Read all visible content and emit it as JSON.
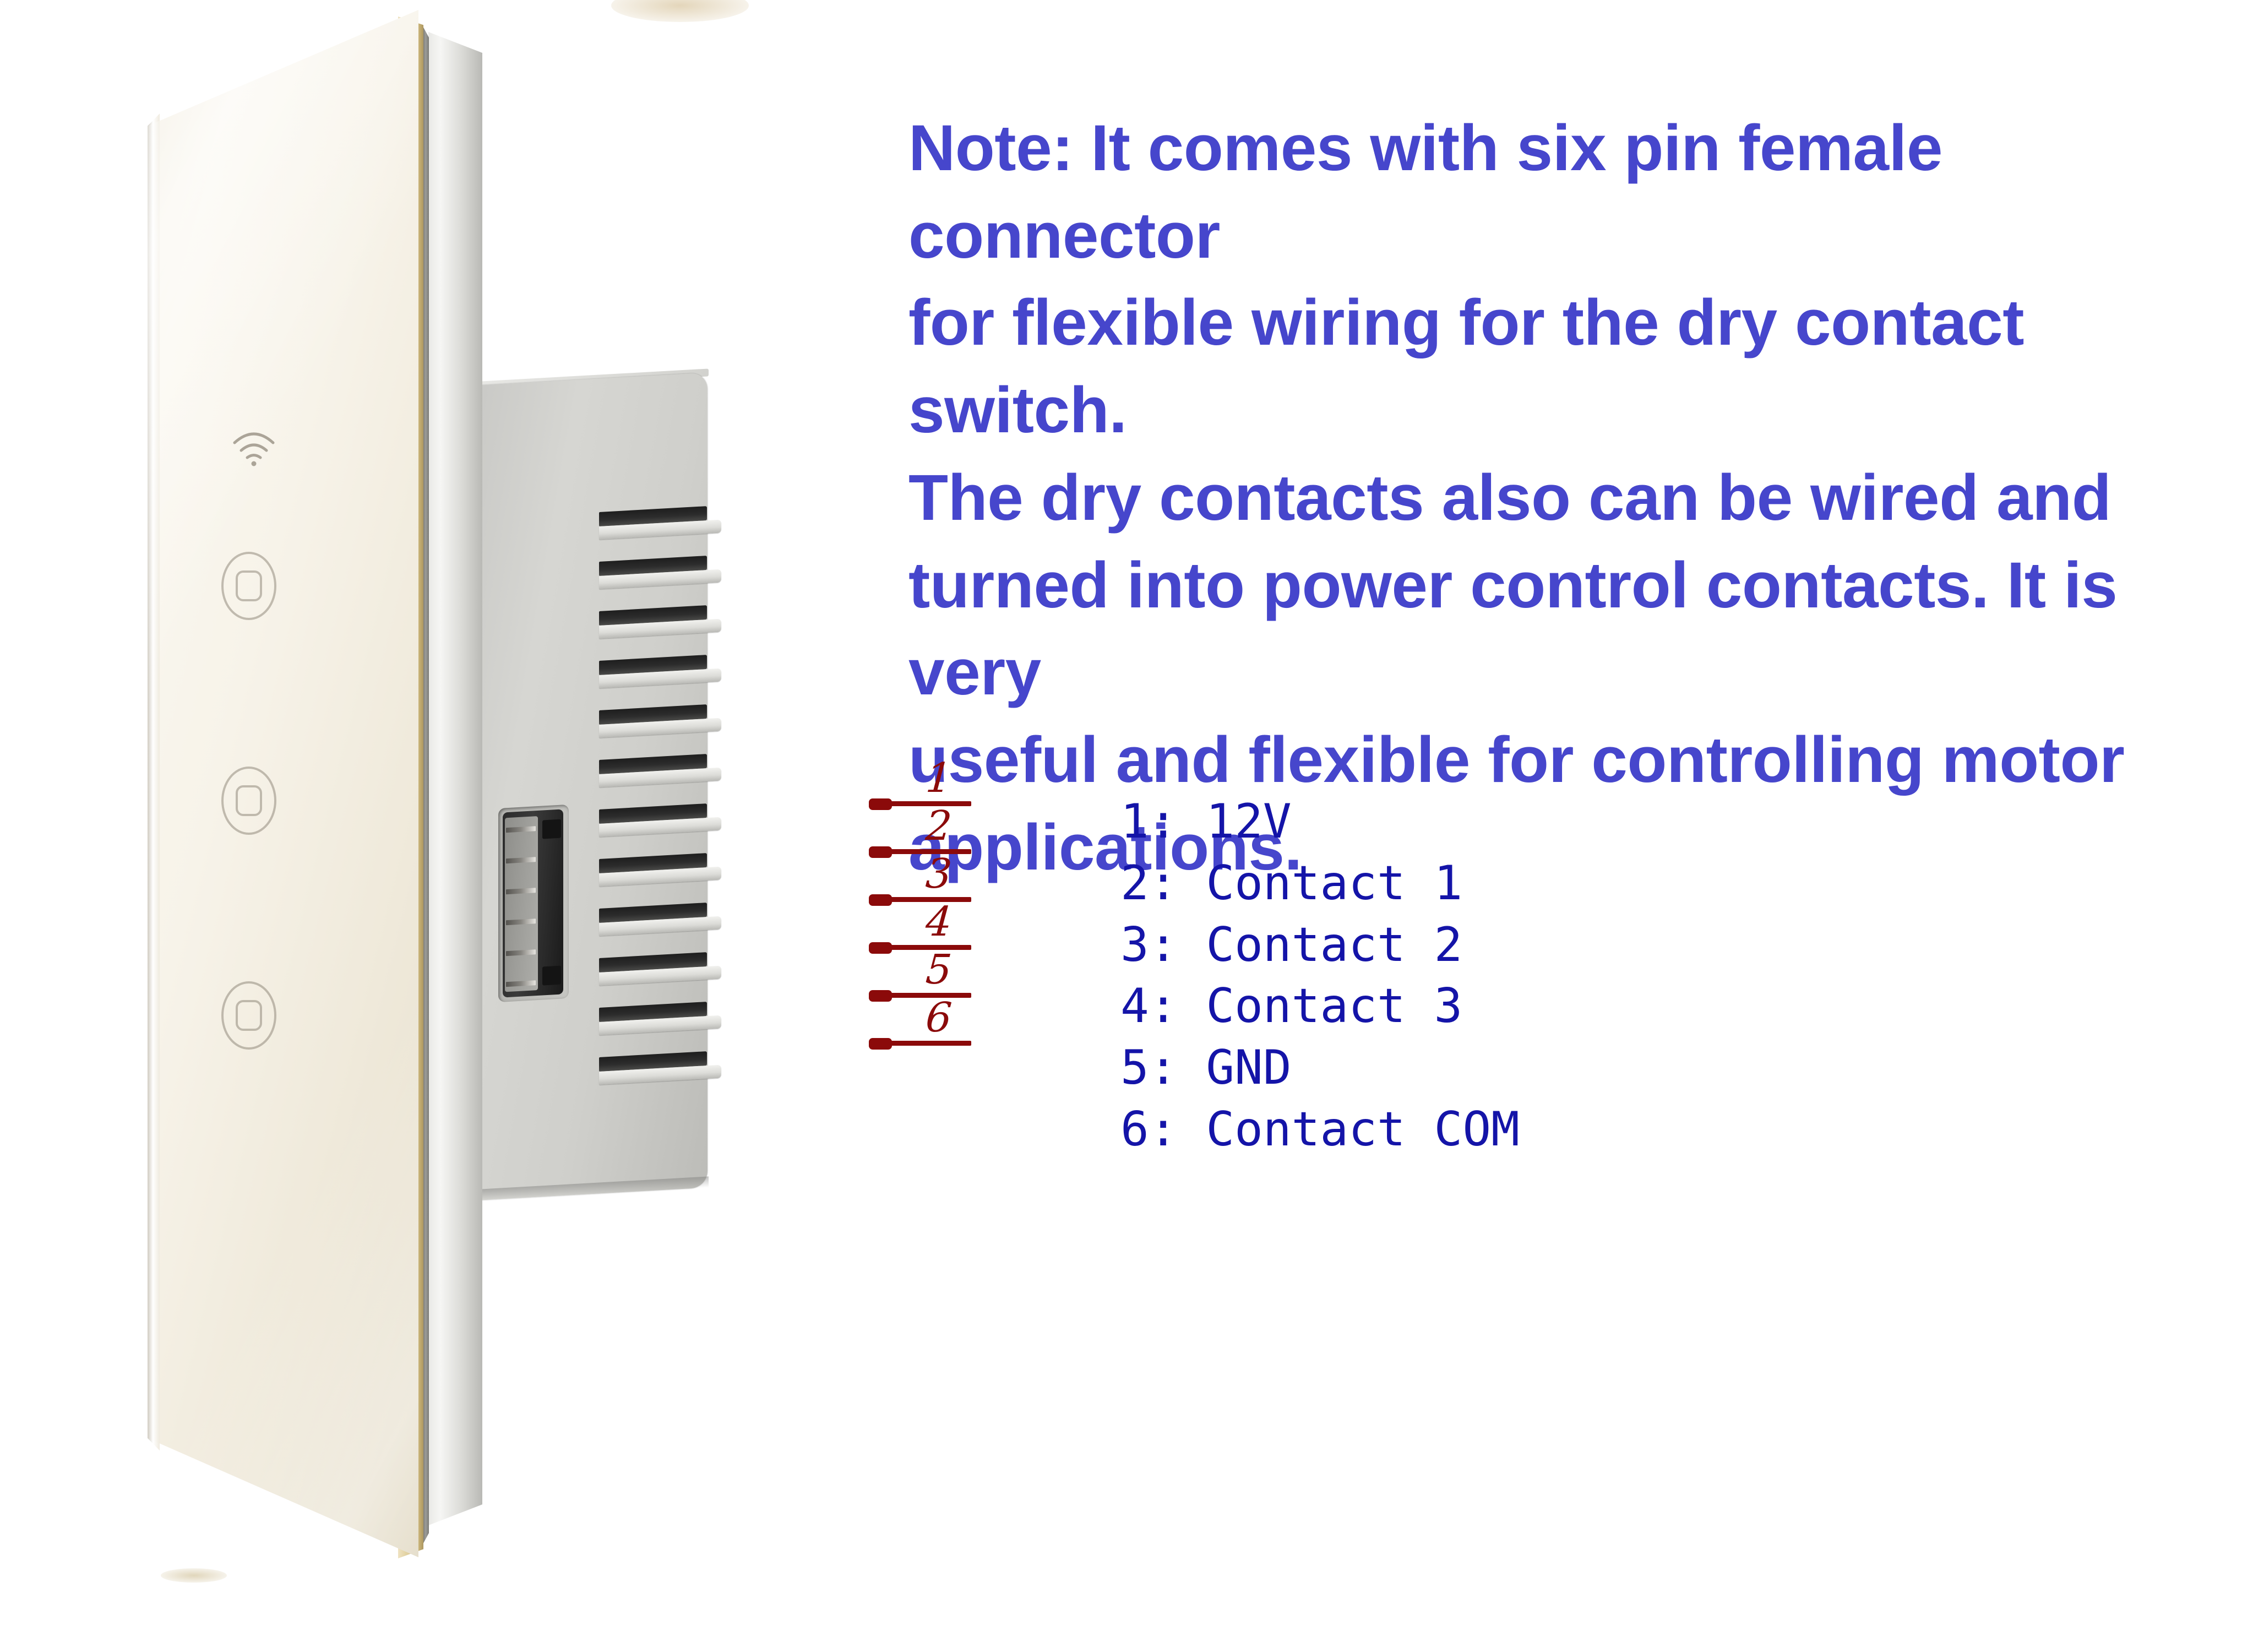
{
  "note": {
    "text": "Note: It comes with six pin female connector for flexible wiring for the dry contact switch. The dry contacts also can be wired and turned into power control contacts. It is very useful and flexible for controlling motor applications.",
    "color": "#4646CC",
    "lines": [
      "Note: It comes with six pin female connector",
      "for flexible wiring for the dry contact switch.",
      "The dry contacts also can be wired and",
      "turned into power control contacts. It is very",
      "useful and flexible for controlling motor",
      "applications."
    ]
  },
  "pin_diagram": {
    "color": "#8B0A0A",
    "pins": [
      {
        "number": "1"
      },
      {
        "number": "2"
      },
      {
        "number": "3"
      },
      {
        "number": "4"
      },
      {
        "number": "5"
      },
      {
        "number": "6"
      }
    ]
  },
  "pin_legend": {
    "color": "#1414A8",
    "rows": [
      {
        "text": "1: 12V"
      },
      {
        "text": "2: Contact 1"
      },
      {
        "text": "3: Contact 2"
      },
      {
        "text": "4: Contact 3"
      },
      {
        "text": "5: GND"
      },
      {
        "text": "6: Contact COM"
      }
    ]
  },
  "product": {
    "name": "Smart WiFi Touch Wall Switch",
    "panel_finish_color": "#F4EFE2",
    "gold_edge_color": "#D9C690",
    "housing_color": "#CFCFCB",
    "touch_keys": 3,
    "connector_pins": 6,
    "icons": {
      "wifi": "wifi-icon",
      "touch_key": "touch-key-icon"
    }
  }
}
